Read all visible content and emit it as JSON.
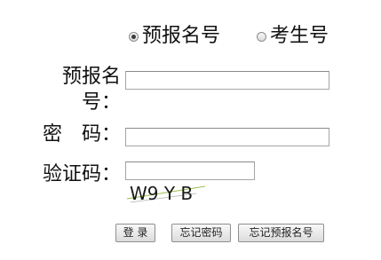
{
  "login_type": {
    "options": [
      {
        "label": "预报名号",
        "checked": true
      },
      {
        "label": "考生号",
        "checked": false
      }
    ]
  },
  "form": {
    "prereg_label_line1": "预报名",
    "prereg_label_line2": "号：",
    "password_label": "密　码：",
    "captcha_label": "验证码：",
    "prereg_value": "",
    "password_value": "",
    "captcha_value": "",
    "captcha_text": "W9 Y B"
  },
  "buttons": {
    "login": "登 录",
    "forgot_password": "忘记密码",
    "forgot_prereg": "忘记预报名号"
  }
}
